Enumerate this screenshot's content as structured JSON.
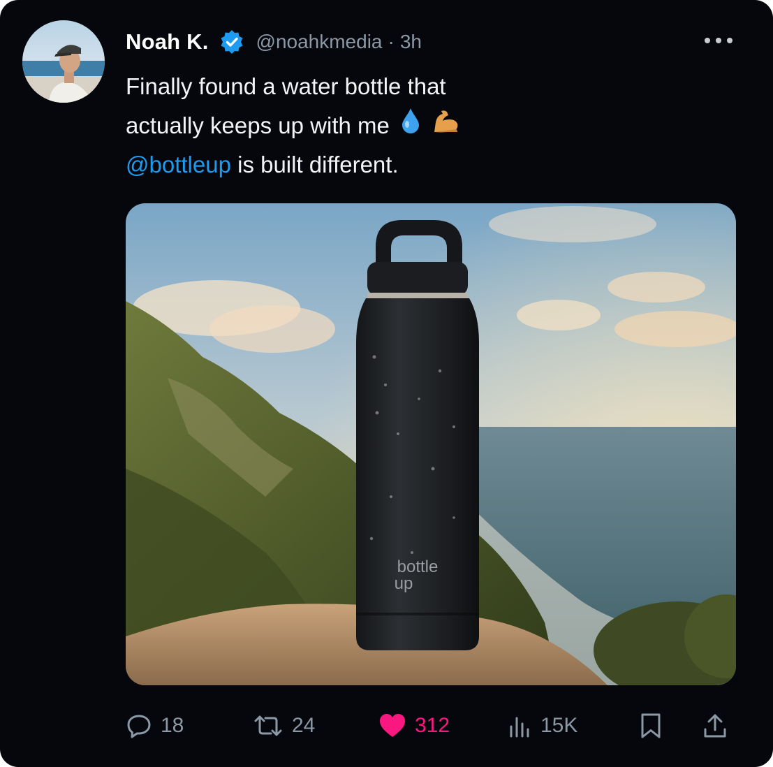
{
  "post": {
    "author_name": "Noah K.",
    "handle": "@noahkmedia",
    "separator": "·",
    "time": "3h",
    "text_line1": "Finally found a water bottle that",
    "text_line2": "actually keeps up with me",
    "emoji1": "💧",
    "emoji2": "💪",
    "mention": "@bottleup",
    "text_line3_rest": " is built different.",
    "bottle_brand_line1": "bottle",
    "bottle_brand_line2": "up"
  },
  "actions": {
    "replies": "18",
    "reposts": "24",
    "likes": "312",
    "views": "15K"
  },
  "colors": {
    "background": "#05070c",
    "accent": "#1d9bf0",
    "like": "#f91880",
    "muted": "#8b98a5"
  },
  "icons": [
    "verified-badge-icon",
    "more-icon",
    "reply-icon",
    "repost-icon",
    "heart-icon",
    "views-icon",
    "bookmark-icon",
    "share-icon"
  ]
}
